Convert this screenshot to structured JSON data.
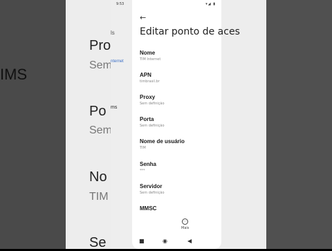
{
  "status": {
    "time": "9:53",
    "icons": "▾◢ ▮"
  },
  "screen": {
    "title": "Editar ponto de aces"
  },
  "fields": [
    {
      "label": "Nome",
      "value": "TIM Internet"
    },
    {
      "label": "APN",
      "value": "timbrasil.br"
    },
    {
      "label": "Proxy",
      "value": "Sem definição"
    },
    {
      "label": "Porta",
      "value": "Sem definição"
    },
    {
      "label": "Nome de usuário",
      "value": "TIM"
    },
    {
      "label": "Senha",
      "value": "***"
    },
    {
      "label": "Servidor",
      "value": "Sem definição"
    },
    {
      "label": "MMSC",
      "value": ""
    }
  ],
  "footer": {
    "more_label": "Mais"
  },
  "background": {
    "left_words": [
      "IMS"
    ],
    "mid_words": [
      "Prox",
      "Sem",
      "Po",
      "Sem",
      "No",
      "TIM",
      "Se",
      "nternet",
      "ms",
      "ls"
    ]
  }
}
